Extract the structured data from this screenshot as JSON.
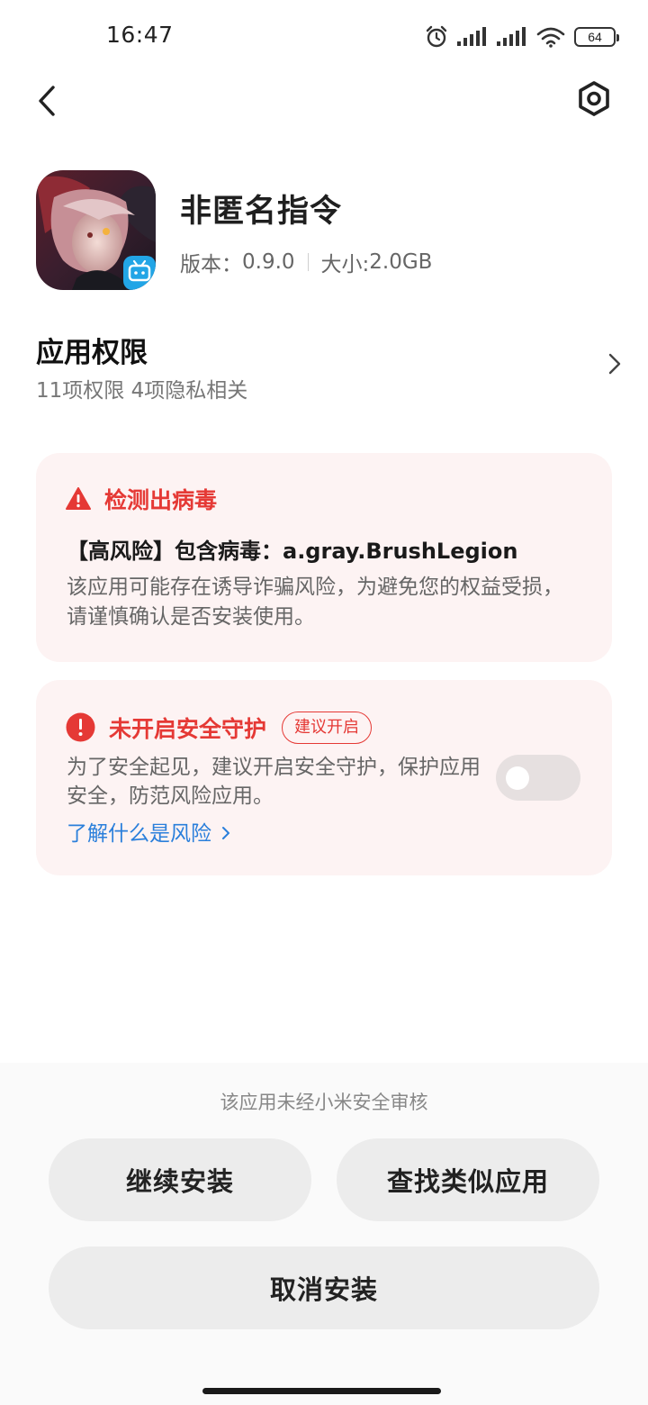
{
  "status_bar": {
    "time": "16:47",
    "battery": "64",
    "icons": [
      "alarm-icon",
      "signal-icon",
      "signal-icon",
      "wifi-icon",
      "battery-icon"
    ]
  },
  "top_bar": {
    "back_icon": "chevron-left-icon",
    "settings_icon": "settings-hexagon-icon"
  },
  "app": {
    "name": "非匿名指令",
    "version_label": "版本：",
    "version": "0.9.0",
    "size_label": "大小:",
    "size": "2.0GB"
  },
  "permissions": {
    "title": "应用权限",
    "summary": "11项权限 4项隐私相关"
  },
  "virus_card": {
    "title": "检测出病毒",
    "risk_line": "【高风险】包含病毒：a.gray.BrushLegion",
    "description": "该应用可能存在诱导诈骗风险，为避免您的权益受损，请谨慎确认是否安装使用。"
  },
  "guard_card": {
    "title": "未开启安全守护",
    "badge": "建议开启",
    "description": "为了安全起见，建议开启安全守护，保护应用安全，防范风险应用。",
    "link": "了解什么是风险",
    "toggle_on": false
  },
  "bottom": {
    "review_note": "该应用未经小米安全审核",
    "continue_label": "继续安装",
    "similar_label": "查找类似应用",
    "cancel_label": "取消安装"
  },
  "colors": {
    "danger": "#e53935",
    "link": "#2a7fdb",
    "card_bg": "#fdf3f3"
  }
}
